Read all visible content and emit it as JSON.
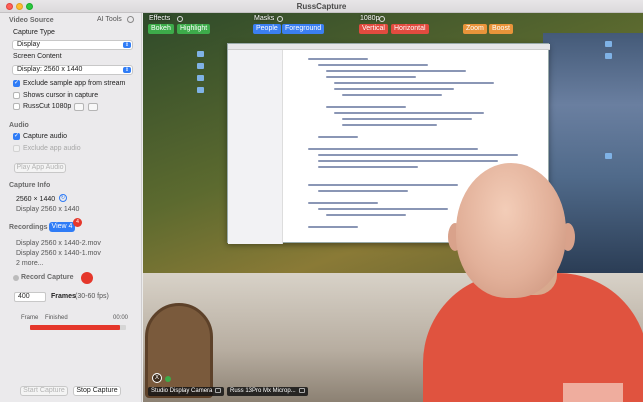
{
  "window": {
    "title": "RussCapture"
  },
  "sidebar": {
    "video_source_title": "Video Source",
    "ai_tools_label": "AI Tools",
    "capture_type_label": "Capture Type",
    "capture_type_value": "Display",
    "screen_content_label": "Screen Content",
    "screen_content_value": "Display: 2560 x 1440",
    "exclude_sample_app_label": "Exclude sample app from stream",
    "shows_cursor_label": "Shows cursor in capture",
    "russcut_label": "RussCut 1080p",
    "audio_title": "Audio",
    "capture_audio_label": "Capture audio",
    "exclude_app_audio_label": "Exclude app audio",
    "play_app_audio_label": "Play App Audio",
    "capture_info_title": "Capture Info",
    "capture_info_res": "2560 × 1440",
    "capture_info_display": "Display 2560 x 1440",
    "recordings_title": "Recordings",
    "view_button_label": "View 4",
    "view_badge_count": "4",
    "recording_files": [
      "Display 2560 x 1440-2.mov",
      "Display 2560 x 1440-1.mov"
    ],
    "more_label": "2 more...",
    "record_capture_label": "Record Capture",
    "frames_value": "400",
    "frames_label": "Frames",
    "frames_fps": "(30-60 fps)",
    "frame_label": "Frame",
    "finished_label": "Finished",
    "time_label": "00:00",
    "progress_fraction": 0.94,
    "start_capture_label": "Start Capture",
    "stop_capture_label": "Stop Capture"
  },
  "overlay": {
    "effects_label": "Effects",
    "bokeh_label": "Bokeh",
    "highlight_label": "Highlight",
    "masks_label": "Masks",
    "people_label": "People",
    "foreground_label": "Foreground",
    "resolution_label": "1080p",
    "vertical_label": "Vertical",
    "horizontal_label": "Horizontal",
    "zoom_label": "Zoom",
    "boost_label": "Boost",
    "camera_label": "Studio Display Camera",
    "mic_label": "Russ 13Pro Mx Microp...",
    "close_glyph": "X"
  },
  "colors": {
    "accent": "#2f7cf6",
    "record_red": "#e5372b",
    "progress_red": "#e5372b",
    "green": "#3dab4a",
    "orange": "#e8943a"
  }
}
